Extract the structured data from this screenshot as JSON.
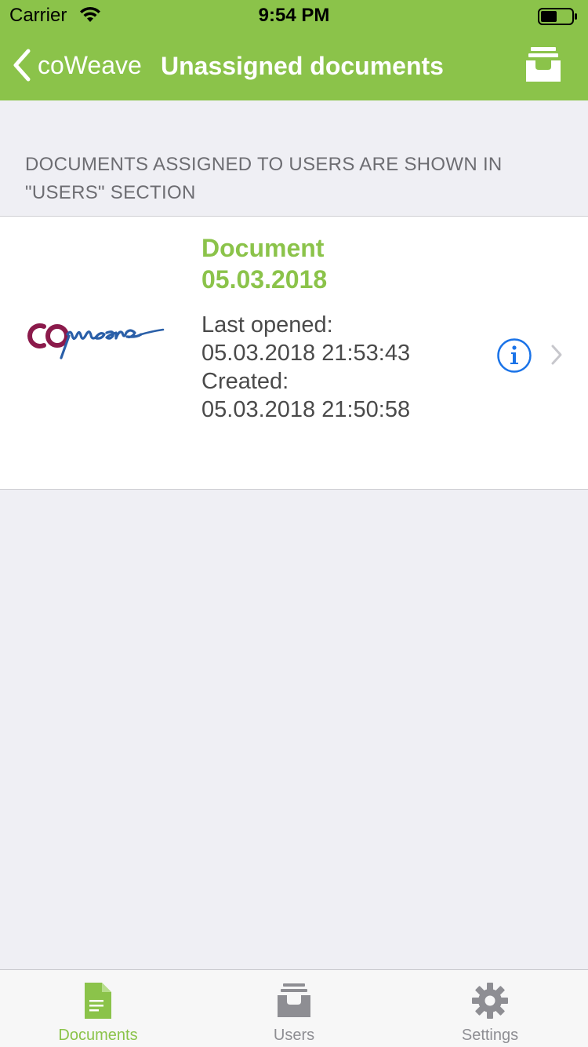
{
  "status_bar": {
    "carrier": "Carrier",
    "time": "9:54 PM"
  },
  "nav": {
    "back_label": "coWeave",
    "title": "Unassigned documents",
    "action_icon": "inbox-tray-icon"
  },
  "section_header": {
    "line1": "DOCUMENTS ASSIGNED TO USERS ARE SHOWN IN",
    "line2": "\"USERS\" SECTION"
  },
  "document": {
    "logo_text": "coweave",
    "title_line1": "Document",
    "title_line2": "05.03.2018",
    "last_opened_label": "Last opened:",
    "last_opened_value": "05.03.2018 21:53:43",
    "created_label": "Created:",
    "created_value": "05.03.2018 21:50:58"
  },
  "tabs": [
    {
      "label": "Documents",
      "icon": "document-icon",
      "active": true
    },
    {
      "label": "Users",
      "icon": "inbox-tray-icon",
      "active": false
    },
    {
      "label": "Settings",
      "icon": "gear-icon",
      "active": false
    }
  ],
  "colors": {
    "accent": "#8bc34a",
    "background": "#efeff4",
    "info_blue": "#1a73e8",
    "logo_maroon": "#8b1a4b",
    "logo_blue": "#2a5fa8"
  }
}
